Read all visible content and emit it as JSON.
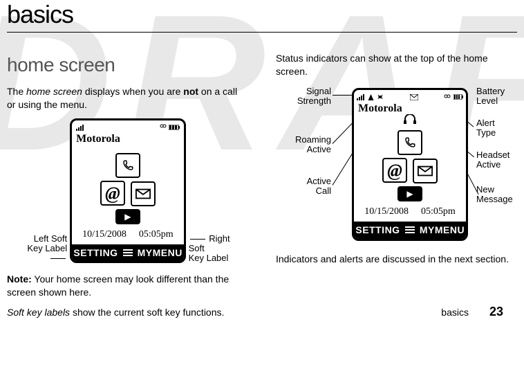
{
  "page": {
    "title": "basics",
    "footer_label": "basics",
    "page_number": "23"
  },
  "left_column": {
    "heading": "home screen",
    "intro_pre": "The ",
    "intro_em": "home screen",
    "intro_mid": " displays when you are ",
    "intro_bold": "not",
    "intro_post": " on a call or using the menu.",
    "note_label": "Note:",
    "note_text": " Your home screen may look different than the screen shown here.",
    "softkey_caption_em": "Soft key labels",
    "softkey_caption_rest": " show the current soft key functions.",
    "left_label_l1": "Left Soft",
    "left_label_l2": "Key Label",
    "right_label_l1": "Right Soft",
    "right_label_l2": "Key Label"
  },
  "right_column": {
    "intro": "Status indicators can show at the top of the home screen.",
    "outro": "Indicators and alerts are discussed in the next section.",
    "callouts": {
      "signal_l1": "Signal",
      "signal_l2": "Strength",
      "roaming_l1": "Roaming",
      "roaming_l2": "Active",
      "active_call_l1": "Active",
      "active_call_l2": "Call",
      "battery_l1": "Battery",
      "battery_l2": "Level",
      "alert_l1": "Alert",
      "alert_l2": "Type",
      "headset_l1": "Headset",
      "headset_l2": "Active",
      "newmsg_l1": "New",
      "newmsg_l2": "Message"
    }
  },
  "phone": {
    "brand": "Motorola",
    "date": "10/15/2008",
    "time": "05:05pm",
    "softkey_left": "SETTING",
    "softkey_right": "MYMENU"
  }
}
